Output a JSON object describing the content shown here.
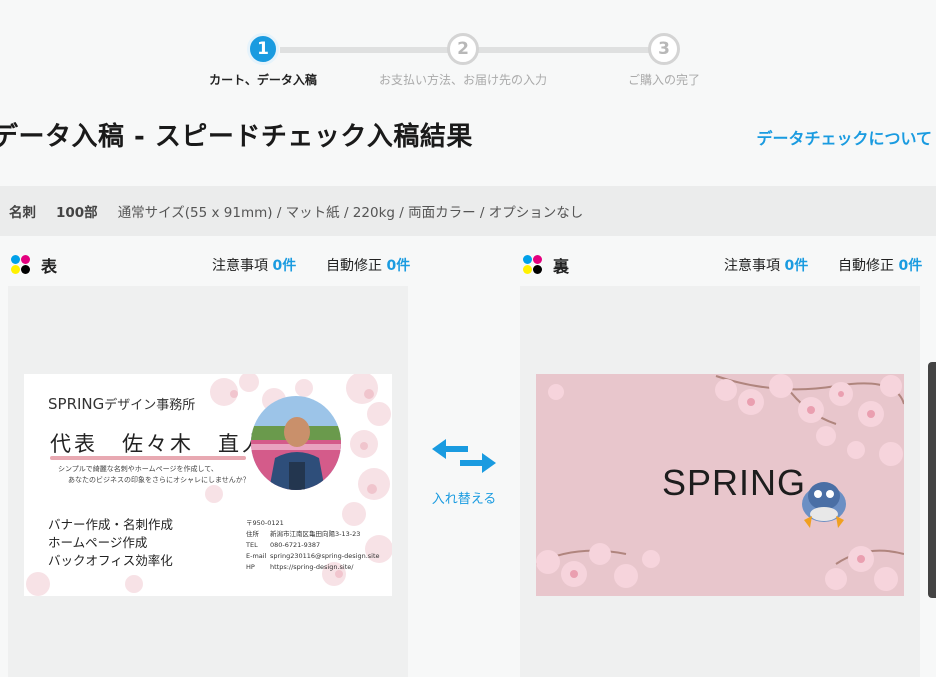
{
  "stepper": {
    "steps": [
      {
        "number": "1",
        "label": "カート、データ入稿"
      },
      {
        "number": "2",
        "label": "お支払い方法、お届け先の入力"
      },
      {
        "number": "3",
        "label": "ご購入の完了"
      }
    ],
    "active_index": 0
  },
  "page": {
    "title": "データ入稿 - スピードチェック入稿結果",
    "check_link": "データチェックについて"
  },
  "spec": {
    "product": "名刺",
    "quantity": "100部",
    "details": "通常サイズ(55 x 91mm) / マット紙 / 220kg / 両面カラー / オプションなし"
  },
  "front_panel": {
    "side_label": "表",
    "notice_label": "注意事項",
    "notice_count": "0件",
    "autofix_label": "自動修正",
    "autofix_count": "0件"
  },
  "back_panel": {
    "side_label": "裏",
    "notice_label": "注意事項",
    "notice_count": "0件",
    "autofix_label": "自動修正",
    "autofix_count": "0件"
  },
  "swap": {
    "label": "入れ替える",
    "icon": "swap-arrows-icon"
  },
  "front_card": {
    "company_latin": "SPRING",
    "company_jp": "デザイン事務所",
    "name": "代表　佐々木　直人",
    "tagline_1": "シンプルで綺麗な名刺やホームページを作成して、",
    "tagline_2": "あなたのビジネスの印象をさらにオシャレにしませんか？",
    "service_1": "バナー作成・名刺作成",
    "service_2": "ホームページ作成",
    "service_3": "バックオフィス効率化",
    "zip": "〒950-0121",
    "address_label": "住所",
    "address": "新潟市江南区亀田向陽3-13-23",
    "tel_label": "TEL",
    "tel": "080-6721-9387",
    "email_label": "E-mail",
    "email": "spring230116@spring-design.site",
    "hp_label": "HP",
    "hp": "https://spring-design.site/"
  },
  "back_card": {
    "logo_text": "SPRING"
  },
  "colors": {
    "accent": "#1a9be0",
    "cmyk_cyan": "#00a0e9",
    "cmyk_magenta": "#e4007f",
    "cmyk_yellow": "#fff100",
    "cmyk_black": "#000000",
    "card_back_bg": "#e8c6cc"
  }
}
